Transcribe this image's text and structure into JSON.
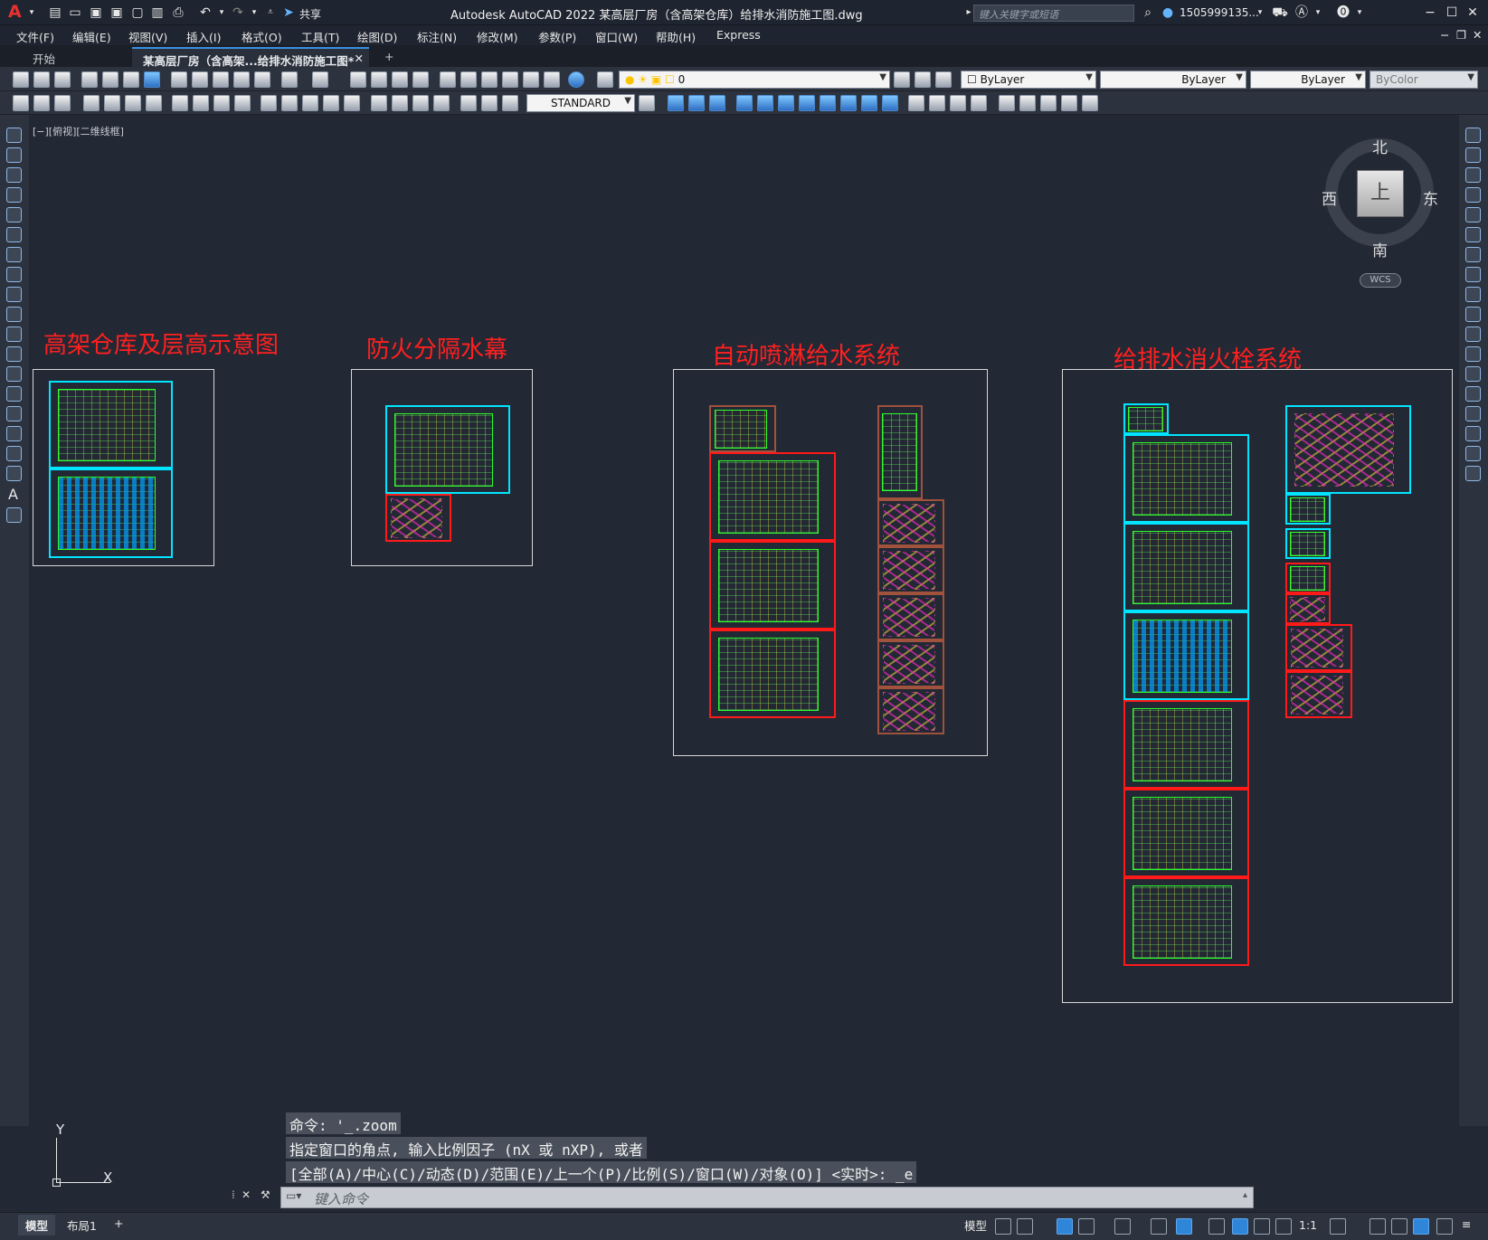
{
  "app": {
    "title": "Autodesk AutoCAD 2022    某高层厂房（含高架仓库）给排水消防施工图.dwg",
    "logo": "A",
    "share_label": "共享",
    "search_placeholder": "键入关键字或短语",
    "user": "1505999135...",
    "colors": {
      "background": "#222834",
      "accent": "#ff2020",
      "cyan": "#00e5ff"
    }
  },
  "menu": [
    "文件(F)",
    "编辑(E)",
    "视图(V)",
    "插入(I)",
    "格式(O)",
    "工具(T)",
    "绘图(D)",
    "标注(N)",
    "修改(M)",
    "参数(P)",
    "窗口(W)",
    "帮助(H)",
    "Express"
  ],
  "tabs": {
    "start": "开始",
    "doc": "某高层厂房（含高架...给排水消防施工图*"
  },
  "toolbar": {
    "layer": "0",
    "color": "ByLayer",
    "linetype": "ByLayer",
    "lineweight": "ByLayer",
    "plotstyle": "ByColor",
    "textstyle": "STANDARD"
  },
  "viewport": {
    "label": "[−][俯视][二维线框]"
  },
  "drawings": [
    {
      "title": "高架仓库及层高示意图"
    },
    {
      "title": "防火分隔水幕"
    },
    {
      "title": "自动喷淋给水系统"
    },
    {
      "title": "给排水消火栓系统"
    }
  ],
  "navcube": {
    "north": "北",
    "south": "南",
    "east": "东",
    "west": "西",
    "face": "上",
    "wcs": "WCS"
  },
  "ucs": {
    "y": "Y",
    "x": "X"
  },
  "command": {
    "history": [
      "命令: '_.zoom",
      "指定窗口的角点, 输入比例因子 (nX 或 nXP), 或者",
      "[全部(A)/中心(C)/动态(D)/范围(E)/上一个(P)/比例(S)/窗口(W)/对象(O)] <实时>: _e"
    ],
    "placeholder": "键入命令"
  },
  "status": {
    "model_tab": "模型",
    "layout_tab": "布局1",
    "model_label": "模型",
    "scale": "1:1"
  }
}
